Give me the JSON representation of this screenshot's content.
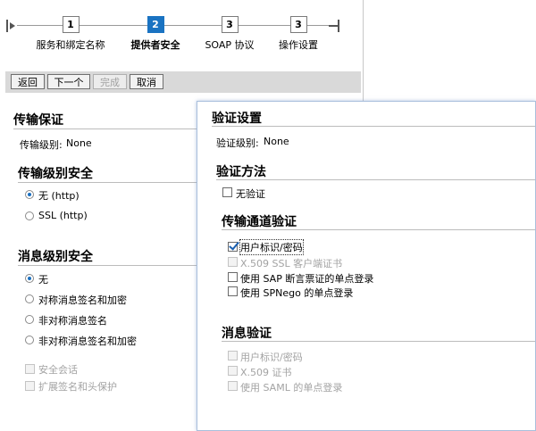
{
  "wizard": {
    "steps": [
      {
        "num": "1",
        "label": "服务和绑定名称"
      },
      {
        "num": "2",
        "label": "提供者安全"
      },
      {
        "num": "3",
        "label": "SOAP 协议"
      },
      {
        "num": "3",
        "label": "操作设置"
      }
    ],
    "active_step": 2
  },
  "toolbar": {
    "back_label": "返回",
    "next_label": "下一个",
    "finish_label": "完成",
    "cancel_label": "取消"
  },
  "left_panel": {
    "transport_guarantee": {
      "heading": "传输保证",
      "level_label": "传输级别:",
      "level_value": "None"
    },
    "transport_level_security": {
      "heading": "传输级别安全",
      "options": [
        "无 (http)",
        "SSL (http)"
      ],
      "selected": 0
    },
    "message_level_security": {
      "heading": "消息级别安全",
      "options": [
        "无",
        "对称消息签名和加密",
        "非对称消息签名",
        "非对称消息签名和加密"
      ],
      "selected": 0,
      "checkboxes": [
        "安全会话",
        "扩展签名和头保护"
      ]
    }
  },
  "right_panel": {
    "auth_settings": {
      "heading": "验证设置",
      "level_label": "验证级别:",
      "level_value": "None"
    },
    "auth_method": {
      "heading": "验证方法",
      "no_auth_label": "无验证"
    },
    "transport_channel_auth": {
      "heading": "传输通道验证",
      "items": [
        {
          "label": "用户标识/密码",
          "checked": true,
          "disabled": false
        },
        {
          "label": "X.509 SSL 客户端证书",
          "checked": false,
          "disabled": true
        },
        {
          "label": "使用 SAP 断言票证的单点登录",
          "checked": false,
          "disabled": false
        },
        {
          "label": "使用 SPNego 的单点登录",
          "checked": false,
          "disabled": false
        }
      ]
    },
    "message_auth": {
      "heading": "消息验证",
      "items": [
        {
          "label": "用户标识/密码",
          "disabled": true
        },
        {
          "label": "X.509 证书",
          "disabled": true
        },
        {
          "label": "使用 SAML 的单点登录",
          "disabled": true
        }
      ]
    }
  }
}
